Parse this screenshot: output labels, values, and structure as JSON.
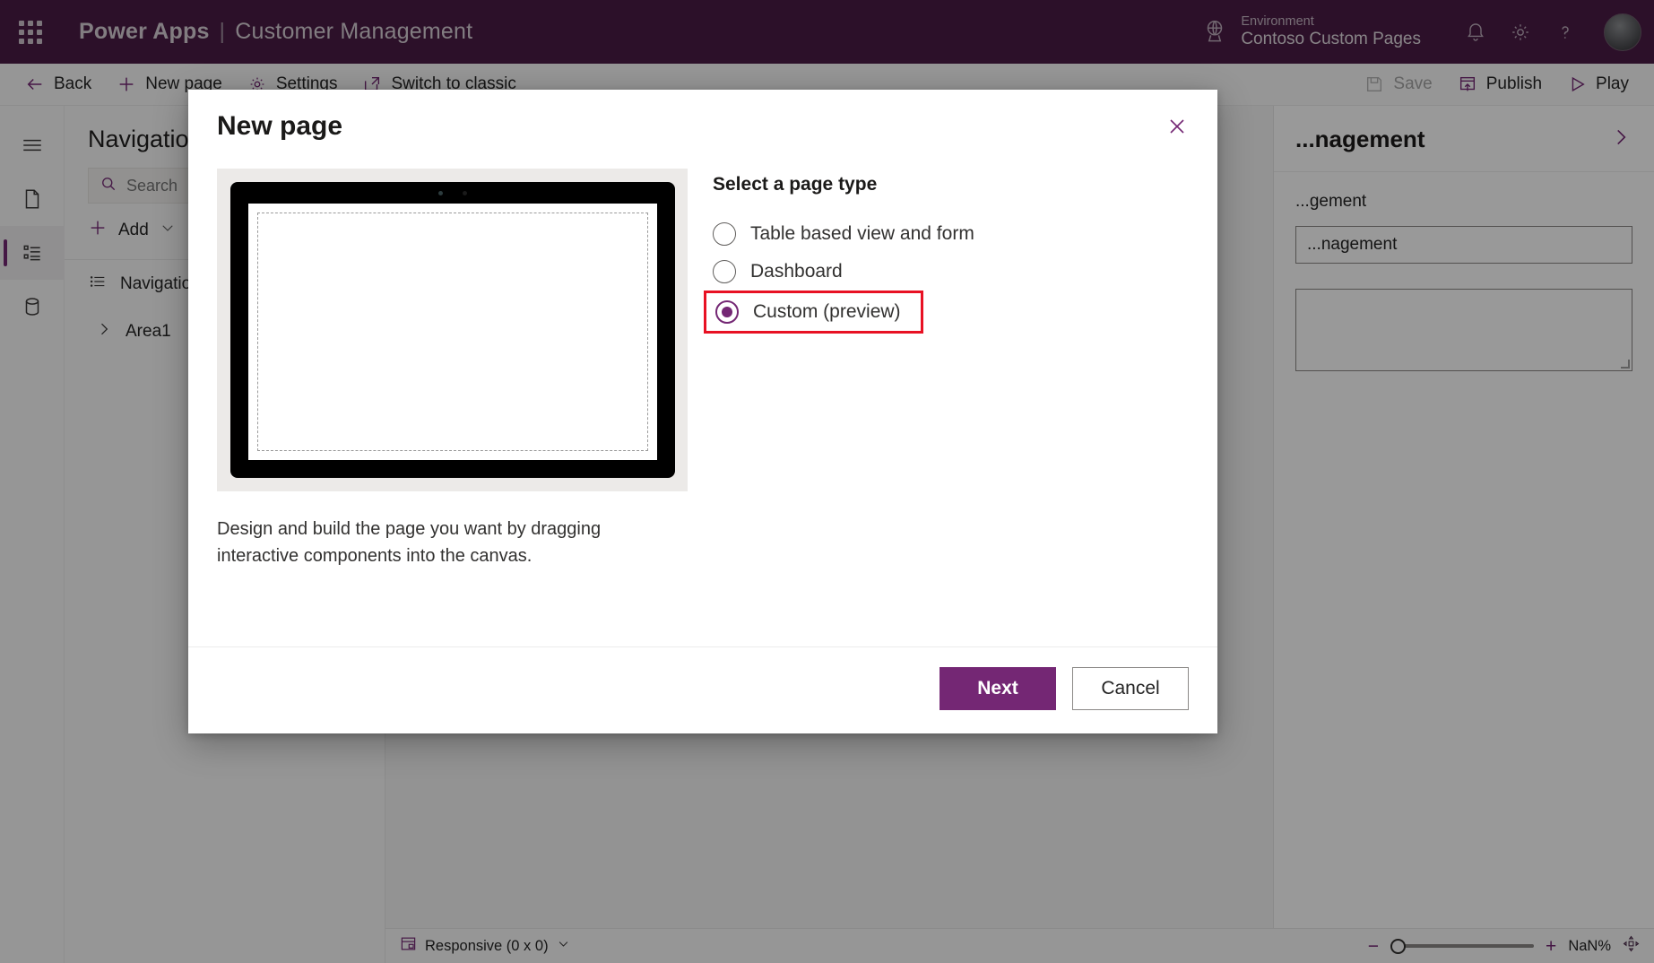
{
  "header": {
    "waffle_name": "app-launcher",
    "product": "Power Apps",
    "separator": "|",
    "app_name": "Customer Management",
    "environment_label": "Environment",
    "environment_name": "Contoso Custom Pages"
  },
  "commandbar": {
    "back": "Back",
    "new_page": "New page",
    "settings": "Settings",
    "switch_to_classic": "Switch to classic",
    "save": "Save",
    "publish": "Publish",
    "play": "Play"
  },
  "navpanel": {
    "title": "Navigation",
    "search_placeholder": "Search",
    "search_value": "",
    "add": "Add",
    "tree": [
      {
        "label": "Navigation"
      },
      {
        "label": "Area1"
      }
    ]
  },
  "properties": {
    "header_title": "...nagement",
    "section_label": "...gement",
    "input_value": "...nagement"
  },
  "dialog": {
    "title": "New page",
    "description": "Design and build the page you want by dragging interactive components into the canvas.",
    "types_title": "Select a page type",
    "options": [
      {
        "label": "Table based view and form",
        "selected": false,
        "highlighted": false
      },
      {
        "label": "Dashboard",
        "selected": false,
        "highlighted": false
      },
      {
        "label": "Custom (preview)",
        "selected": true,
        "highlighted": true
      }
    ],
    "next": "Next",
    "cancel": "Cancel"
  },
  "statusbar": {
    "responsive": "Responsive (0 x 0)",
    "zoom_value": "NaN%",
    "zoom_minus": "−",
    "zoom_plus": "+"
  },
  "colors": {
    "brand_purple": "#4a1c45",
    "accent_purple": "#742774",
    "highlight_red": "#e81123"
  }
}
